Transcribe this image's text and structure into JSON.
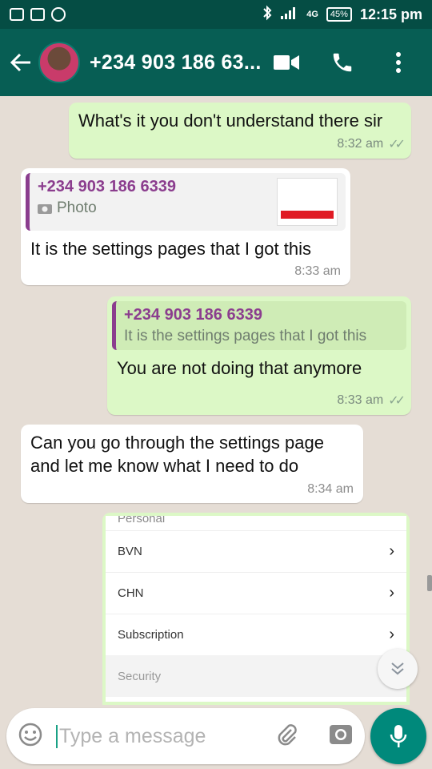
{
  "status_bar": {
    "network": "4G",
    "battery": "45%",
    "time": "12:15 pm"
  },
  "header": {
    "contact_name": "+234 903 186 63..."
  },
  "messages": [
    {
      "direction": "out",
      "text": "What's it you don't understand there sir",
      "time": "8:32 am",
      "ticks": "✓✓"
    },
    {
      "direction": "in",
      "quote": {
        "name": "+234 903 186 6339",
        "text": "Photo",
        "icon": "camera-icon"
      },
      "text": "It is the settings pages that I got this",
      "time": "8:33 am"
    },
    {
      "direction": "out",
      "quote": {
        "name": "+234 903 186 6339",
        "text": "It is the settings pages that I got this"
      },
      "text": "You are not doing that anymore",
      "time": "8:33 am",
      "ticks": "✓✓"
    },
    {
      "direction": "in",
      "text": "Can you go through the settings page and let me know what I need to do",
      "time": "8:34 am"
    }
  ],
  "screenshot": {
    "section_top": "Personal",
    "rows": [
      "BVN",
      "CHN",
      "Subscription"
    ],
    "section_bottom": "Security"
  },
  "input": {
    "placeholder": "Type a message"
  },
  "colors": {
    "status_bar": "#054d44",
    "app_bar": "#075e54",
    "outgoing_bubble": "#dcf8c6",
    "incoming_bubble": "#ffffff",
    "quote_name": "#8b3d8e",
    "mic_button": "#00897b"
  }
}
